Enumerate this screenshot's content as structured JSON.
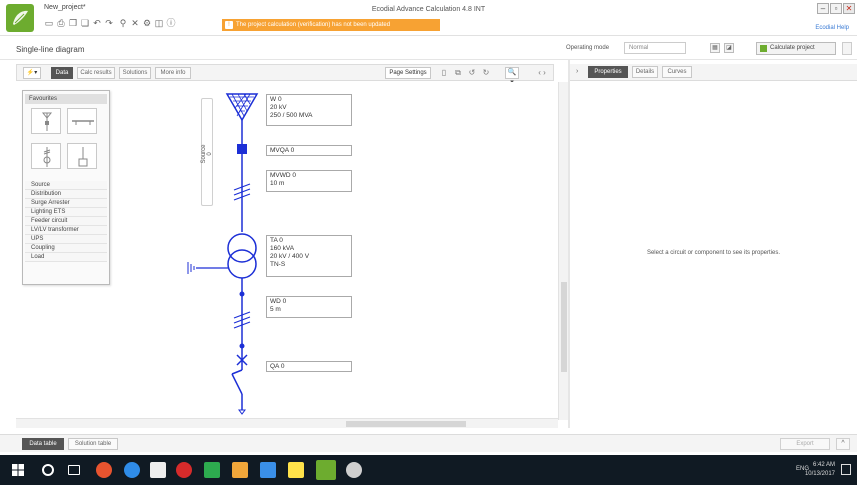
{
  "window": {
    "project_name": "New_project*",
    "title": "Ecodial Advance Calculation 4.8 INT",
    "warning": "The project calculation (verification) has not been updated",
    "help_link": "Ecodial Help",
    "minimize": "–",
    "maximize": "▫",
    "close": "✕"
  },
  "header": {
    "page_title": "Single-line diagram",
    "operating_mode_label": "Operating mode",
    "operating_mode_value": "Normal",
    "calculate_button": "Calculate project"
  },
  "toolbar": {
    "dropdown": "⚡▾",
    "tabs": [
      "Data",
      "Calc results",
      "Solutions",
      "More info"
    ],
    "page_settings": "Page Settings",
    "zoom": "🔍▾",
    "expand": "‹ ›"
  },
  "palette": {
    "favourites_label": "Favourites",
    "categories": [
      "Source",
      "Distribution",
      "Surge Arrester",
      "Lighting ETS",
      "Feeder circuit",
      "LV/LV transformer",
      "UPS",
      "Coupling",
      "Load"
    ]
  },
  "diagram": {
    "source_label": "Source 0",
    "components": [
      {
        "id": "w0",
        "lines": [
          "W 0",
          "20 kV",
          "250 / 500 MVA"
        ]
      },
      {
        "id": "mvqa0",
        "lines": [
          "MVQA 0"
        ]
      },
      {
        "id": "mvwd0",
        "lines": [
          "MVWD 0",
          "10 m"
        ]
      },
      {
        "id": "ta0",
        "lines": [
          "TA 0",
          "160 kVA",
          "20 kV / 400 V",
          "TN-S"
        ]
      },
      {
        "id": "wd0",
        "lines": [
          "WD 0",
          "5 m"
        ]
      },
      {
        "id": "qa0",
        "lines": [
          "QA 0"
        ]
      }
    ]
  },
  "right_panel": {
    "tabs": [
      "Properties",
      "Details",
      "Curves"
    ],
    "message": "Select a circuit or component to see its properties."
  },
  "bottom": {
    "tabs": [
      "Data table",
      "Solution table"
    ],
    "export": "Export",
    "expand": "^"
  },
  "taskbar": {
    "language": "ENG",
    "time": "6:42 AM",
    "date": "10/13/2017"
  },
  "colors": {
    "accent_green": "#6dac2f",
    "warning_orange": "#f7a233",
    "diagram_blue": "#1c2fd6"
  }
}
